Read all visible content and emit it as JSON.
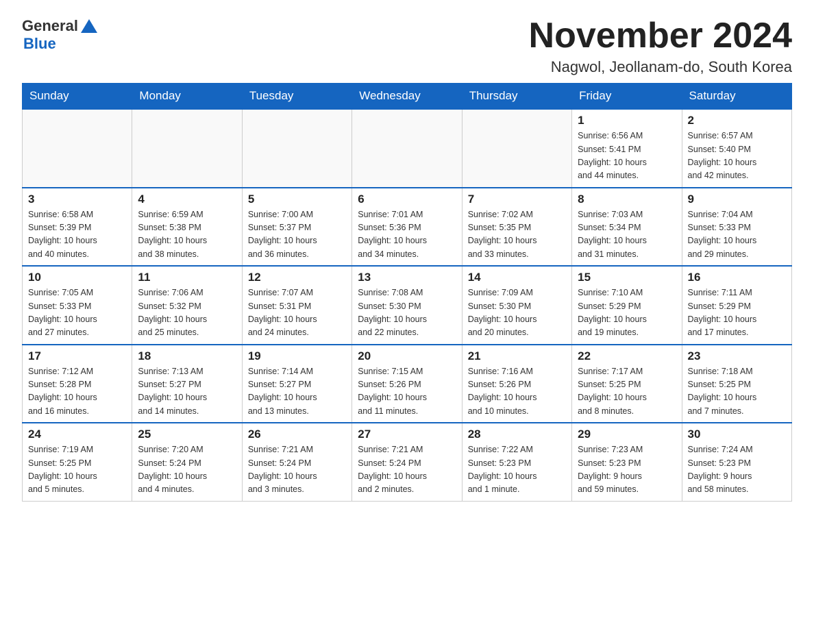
{
  "header": {
    "logo_general": "General",
    "logo_blue": "Blue",
    "title": "November 2024",
    "subtitle": "Nagwol, Jeollanam-do, South Korea"
  },
  "weekdays": [
    "Sunday",
    "Monday",
    "Tuesday",
    "Wednesday",
    "Thursday",
    "Friday",
    "Saturday"
  ],
  "weeks": [
    {
      "days": [
        {
          "num": "",
          "info": ""
        },
        {
          "num": "",
          "info": ""
        },
        {
          "num": "",
          "info": ""
        },
        {
          "num": "",
          "info": ""
        },
        {
          "num": "",
          "info": ""
        },
        {
          "num": "1",
          "info": "Sunrise: 6:56 AM\nSunset: 5:41 PM\nDaylight: 10 hours\nand 44 minutes."
        },
        {
          "num": "2",
          "info": "Sunrise: 6:57 AM\nSunset: 5:40 PM\nDaylight: 10 hours\nand 42 minutes."
        }
      ]
    },
    {
      "days": [
        {
          "num": "3",
          "info": "Sunrise: 6:58 AM\nSunset: 5:39 PM\nDaylight: 10 hours\nand 40 minutes."
        },
        {
          "num": "4",
          "info": "Sunrise: 6:59 AM\nSunset: 5:38 PM\nDaylight: 10 hours\nand 38 minutes."
        },
        {
          "num": "5",
          "info": "Sunrise: 7:00 AM\nSunset: 5:37 PM\nDaylight: 10 hours\nand 36 minutes."
        },
        {
          "num": "6",
          "info": "Sunrise: 7:01 AM\nSunset: 5:36 PM\nDaylight: 10 hours\nand 34 minutes."
        },
        {
          "num": "7",
          "info": "Sunrise: 7:02 AM\nSunset: 5:35 PM\nDaylight: 10 hours\nand 33 minutes."
        },
        {
          "num": "8",
          "info": "Sunrise: 7:03 AM\nSunset: 5:34 PM\nDaylight: 10 hours\nand 31 minutes."
        },
        {
          "num": "9",
          "info": "Sunrise: 7:04 AM\nSunset: 5:33 PM\nDaylight: 10 hours\nand 29 minutes."
        }
      ]
    },
    {
      "days": [
        {
          "num": "10",
          "info": "Sunrise: 7:05 AM\nSunset: 5:33 PM\nDaylight: 10 hours\nand 27 minutes."
        },
        {
          "num": "11",
          "info": "Sunrise: 7:06 AM\nSunset: 5:32 PM\nDaylight: 10 hours\nand 25 minutes."
        },
        {
          "num": "12",
          "info": "Sunrise: 7:07 AM\nSunset: 5:31 PM\nDaylight: 10 hours\nand 24 minutes."
        },
        {
          "num": "13",
          "info": "Sunrise: 7:08 AM\nSunset: 5:30 PM\nDaylight: 10 hours\nand 22 minutes."
        },
        {
          "num": "14",
          "info": "Sunrise: 7:09 AM\nSunset: 5:30 PM\nDaylight: 10 hours\nand 20 minutes."
        },
        {
          "num": "15",
          "info": "Sunrise: 7:10 AM\nSunset: 5:29 PM\nDaylight: 10 hours\nand 19 minutes."
        },
        {
          "num": "16",
          "info": "Sunrise: 7:11 AM\nSunset: 5:29 PM\nDaylight: 10 hours\nand 17 minutes."
        }
      ]
    },
    {
      "days": [
        {
          "num": "17",
          "info": "Sunrise: 7:12 AM\nSunset: 5:28 PM\nDaylight: 10 hours\nand 16 minutes."
        },
        {
          "num": "18",
          "info": "Sunrise: 7:13 AM\nSunset: 5:27 PM\nDaylight: 10 hours\nand 14 minutes."
        },
        {
          "num": "19",
          "info": "Sunrise: 7:14 AM\nSunset: 5:27 PM\nDaylight: 10 hours\nand 13 minutes."
        },
        {
          "num": "20",
          "info": "Sunrise: 7:15 AM\nSunset: 5:26 PM\nDaylight: 10 hours\nand 11 minutes."
        },
        {
          "num": "21",
          "info": "Sunrise: 7:16 AM\nSunset: 5:26 PM\nDaylight: 10 hours\nand 10 minutes."
        },
        {
          "num": "22",
          "info": "Sunrise: 7:17 AM\nSunset: 5:25 PM\nDaylight: 10 hours\nand 8 minutes."
        },
        {
          "num": "23",
          "info": "Sunrise: 7:18 AM\nSunset: 5:25 PM\nDaylight: 10 hours\nand 7 minutes."
        }
      ]
    },
    {
      "days": [
        {
          "num": "24",
          "info": "Sunrise: 7:19 AM\nSunset: 5:25 PM\nDaylight: 10 hours\nand 5 minutes."
        },
        {
          "num": "25",
          "info": "Sunrise: 7:20 AM\nSunset: 5:24 PM\nDaylight: 10 hours\nand 4 minutes."
        },
        {
          "num": "26",
          "info": "Sunrise: 7:21 AM\nSunset: 5:24 PM\nDaylight: 10 hours\nand 3 minutes."
        },
        {
          "num": "27",
          "info": "Sunrise: 7:21 AM\nSunset: 5:24 PM\nDaylight: 10 hours\nand 2 minutes."
        },
        {
          "num": "28",
          "info": "Sunrise: 7:22 AM\nSunset: 5:23 PM\nDaylight: 10 hours\nand 1 minute."
        },
        {
          "num": "29",
          "info": "Sunrise: 7:23 AM\nSunset: 5:23 PM\nDaylight: 9 hours\nand 59 minutes."
        },
        {
          "num": "30",
          "info": "Sunrise: 7:24 AM\nSunset: 5:23 PM\nDaylight: 9 hours\nand 58 minutes."
        }
      ]
    }
  ]
}
